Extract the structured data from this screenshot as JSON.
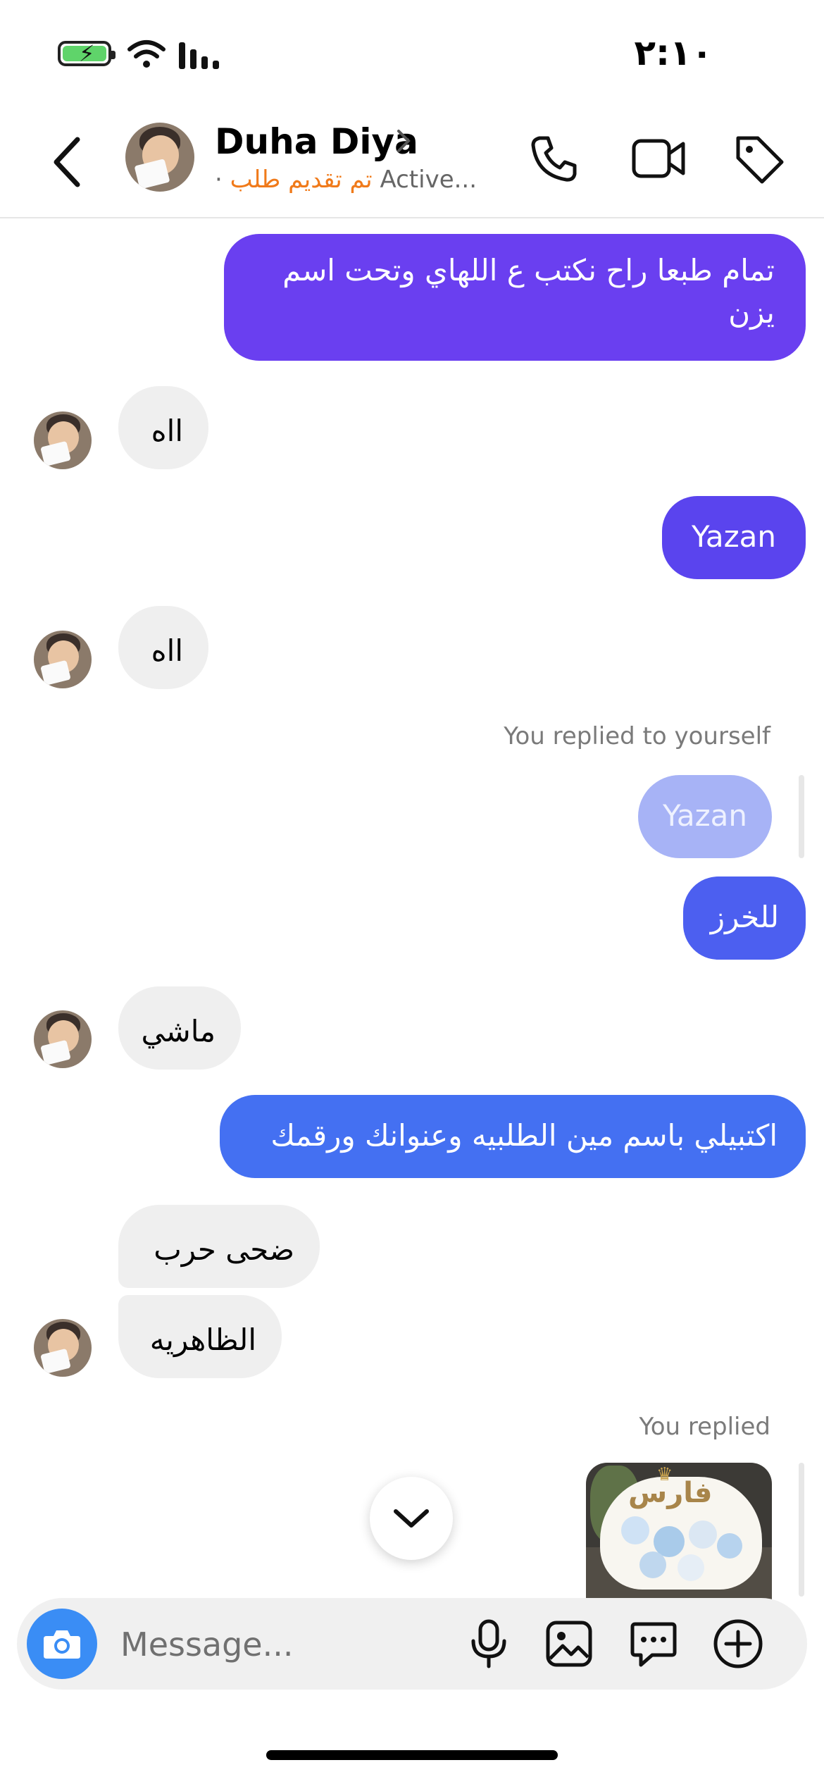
{
  "status_bar": {
    "time": "٢:١٠"
  },
  "header": {
    "name": "Duha Diya",
    "status_dot": "·",
    "status_label": "تم تقديم طلب",
    "activity": "Active..."
  },
  "messages": [
    {
      "dir": "out",
      "text": "تمام طبعا راح نكتب ع اللهاي وتحت اسم يزن"
    },
    {
      "dir": "in",
      "text": "ااه"
    },
    {
      "dir": "out",
      "text": "Yazan"
    },
    {
      "dir": "in",
      "text": "ااه"
    },
    {
      "dir": "label",
      "text": "You replied to yourself"
    },
    {
      "dir": "quoted",
      "text": "Yazan"
    },
    {
      "dir": "out",
      "text": "للخرز"
    },
    {
      "dir": "in",
      "text": "ماشي"
    },
    {
      "dir": "out",
      "text": "اكتبيلي باسم مين الطلبيه وعنوانك ورقمك"
    },
    {
      "dir": "in",
      "text": "ضحى حرب"
    },
    {
      "dir": "in",
      "text": "الظاهريه"
    },
    {
      "dir": "label",
      "text": "You replied"
    },
    {
      "dir": "image",
      "caption": "فارس"
    }
  ],
  "composer": {
    "placeholder": "Message..."
  },
  "colors": {
    "bubble_purple": "#6a3ff0",
    "bubble_indigo": "#5a44ee",
    "bubble_blue": "#4c5ff0",
    "bubble_blue2": "#4470f2",
    "quoted": "#a7b3f6",
    "orange": "#f07a1a"
  },
  "icons": [
    "back-icon",
    "chevron-right-icon",
    "phone-icon",
    "video-icon",
    "tag-icon",
    "camera-icon",
    "microphone-icon",
    "gallery-icon",
    "sticker-icon",
    "plus-icon",
    "chevron-down-icon"
  ]
}
